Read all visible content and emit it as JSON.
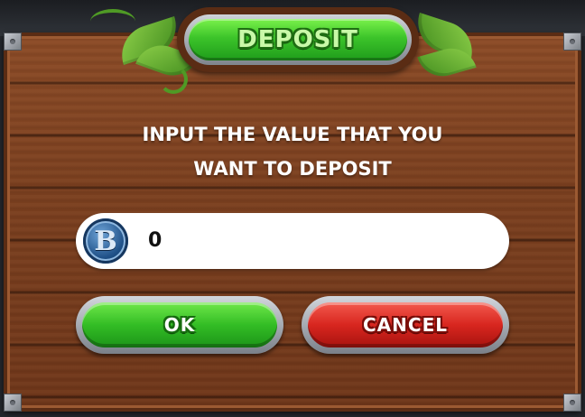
{
  "dialog": {
    "title": "DEPOSIT",
    "prompt_line1": "INPUT THE VALUE THAT YOU",
    "prompt_line2": "WANT TO DEPOSIT"
  },
  "amount_field": {
    "currency_icon": "coin-b-icon",
    "currency_letter": "B",
    "value": "0"
  },
  "buttons": {
    "ok_label": "OK",
    "cancel_label": "CANCEL"
  },
  "colors": {
    "ok": "#33bd25",
    "cancel": "#d8261f",
    "title": "#3cc42a",
    "wood": "#7a3f1f"
  }
}
